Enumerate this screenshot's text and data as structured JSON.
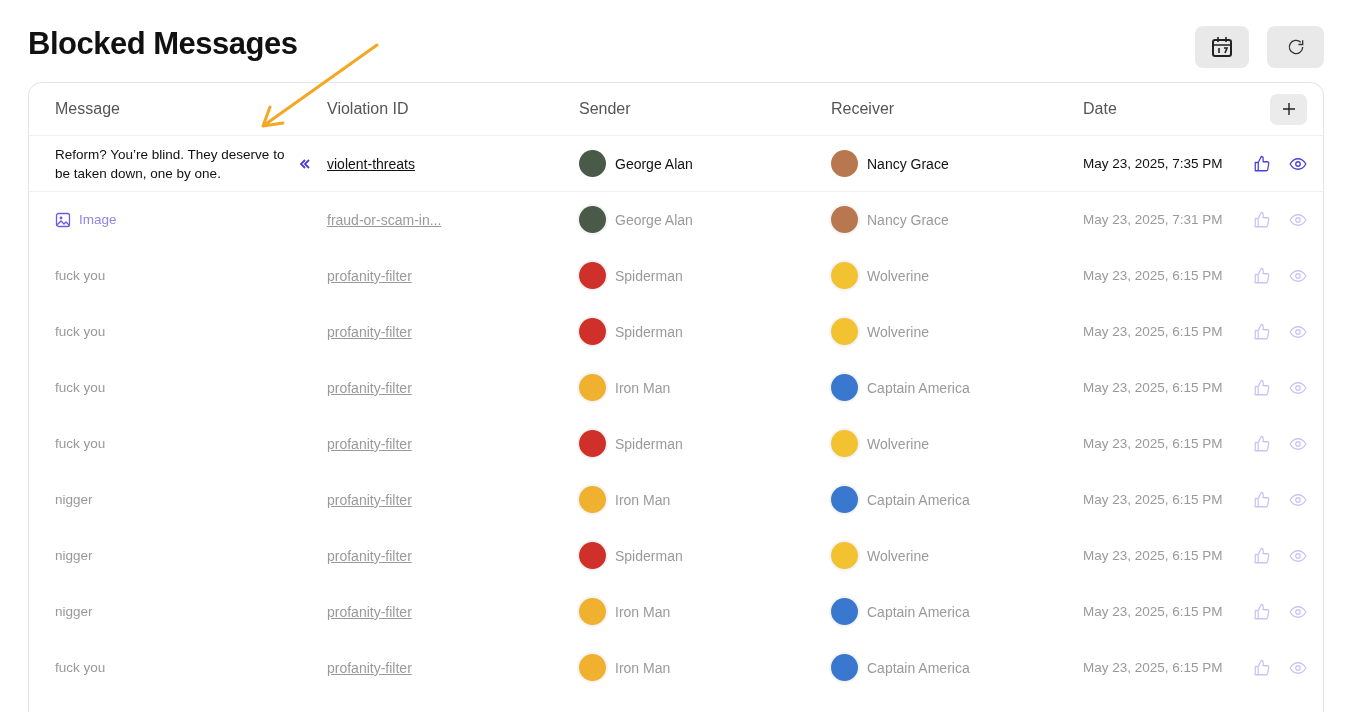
{
  "title": "Blocked Messages",
  "columns": [
    "Message",
    "Violation ID",
    "Sender",
    "Receiver",
    "Date"
  ],
  "rows": [
    {
      "kind": "text",
      "message": "Reform? You’re blind. They deserve to be taken down, one by one.",
      "expanded": true,
      "faded": false,
      "violation": "violent-threats",
      "sender": {
        "name": "George Alan",
        "color": "#4a5a48"
      },
      "receiver": {
        "name": "Nancy Grace",
        "color": "#b9774f"
      },
      "date": "May 23, 2025, 7:35 PM"
    },
    {
      "kind": "image",
      "message": "Image",
      "expanded": false,
      "faded": true,
      "violation": "fraud-or-scam-in...",
      "sender": {
        "name": "George Alan",
        "color": "#4a5a48"
      },
      "receiver": {
        "name": "Nancy Grace",
        "color": "#b9774f"
      },
      "date": "May 23, 2025, 7:31 PM"
    },
    {
      "kind": "text",
      "message": "fuck you",
      "expanded": false,
      "faded": true,
      "violation": "profanity-filter",
      "sender": {
        "name": "Spiderman",
        "color": "#d0302a"
      },
      "receiver": {
        "name": "Wolverine",
        "color": "#f2c230"
      },
      "date": "May 23, 2025, 6:15 PM"
    },
    {
      "kind": "text",
      "message": "fuck you",
      "expanded": false,
      "faded": true,
      "violation": "profanity-filter",
      "sender": {
        "name": "Spiderman",
        "color": "#d0302a"
      },
      "receiver": {
        "name": "Wolverine",
        "color": "#f2c230"
      },
      "date": "May 23, 2025, 6:15 PM"
    },
    {
      "kind": "text",
      "message": "fuck you",
      "expanded": false,
      "faded": true,
      "violation": "profanity-filter",
      "sender": {
        "name": "Iron Man",
        "color": "#f0b030"
      },
      "receiver": {
        "name": "Captain America",
        "color": "#3a78d0"
      },
      "date": "May 23, 2025, 6:15 PM"
    },
    {
      "kind": "text",
      "message": "fuck you",
      "expanded": false,
      "faded": true,
      "violation": "profanity-filter",
      "sender": {
        "name": "Spiderman",
        "color": "#d0302a"
      },
      "receiver": {
        "name": "Wolverine",
        "color": "#f2c230"
      },
      "date": "May 23, 2025, 6:15 PM"
    },
    {
      "kind": "text",
      "message": "nigger",
      "expanded": false,
      "faded": true,
      "violation": "profanity-filter",
      "sender": {
        "name": "Iron Man",
        "color": "#f0b030"
      },
      "receiver": {
        "name": "Captain America",
        "color": "#3a78d0"
      },
      "date": "May 23, 2025, 6:15 PM"
    },
    {
      "kind": "text",
      "message": "nigger",
      "expanded": false,
      "faded": true,
      "violation": "profanity-filter",
      "sender": {
        "name": "Spiderman",
        "color": "#d0302a"
      },
      "receiver": {
        "name": "Wolverine",
        "color": "#f2c230"
      },
      "date": "May 23, 2025, 6:15 PM"
    },
    {
      "kind": "text",
      "message": "nigger",
      "expanded": false,
      "faded": true,
      "violation": "profanity-filter",
      "sender": {
        "name": "Iron Man",
        "color": "#f0b030"
      },
      "receiver": {
        "name": "Captain America",
        "color": "#3a78d0"
      },
      "date": "May 23, 2025, 6:15 PM"
    },
    {
      "kind": "text",
      "message": "fuck you",
      "expanded": false,
      "faded": true,
      "violation": "profanity-filter",
      "sender": {
        "name": "Iron Man",
        "color": "#f0b030"
      },
      "receiver": {
        "name": "Captain America",
        "color": "#3a78d0"
      },
      "date": "May 23, 2025, 6:15 PM"
    }
  ]
}
